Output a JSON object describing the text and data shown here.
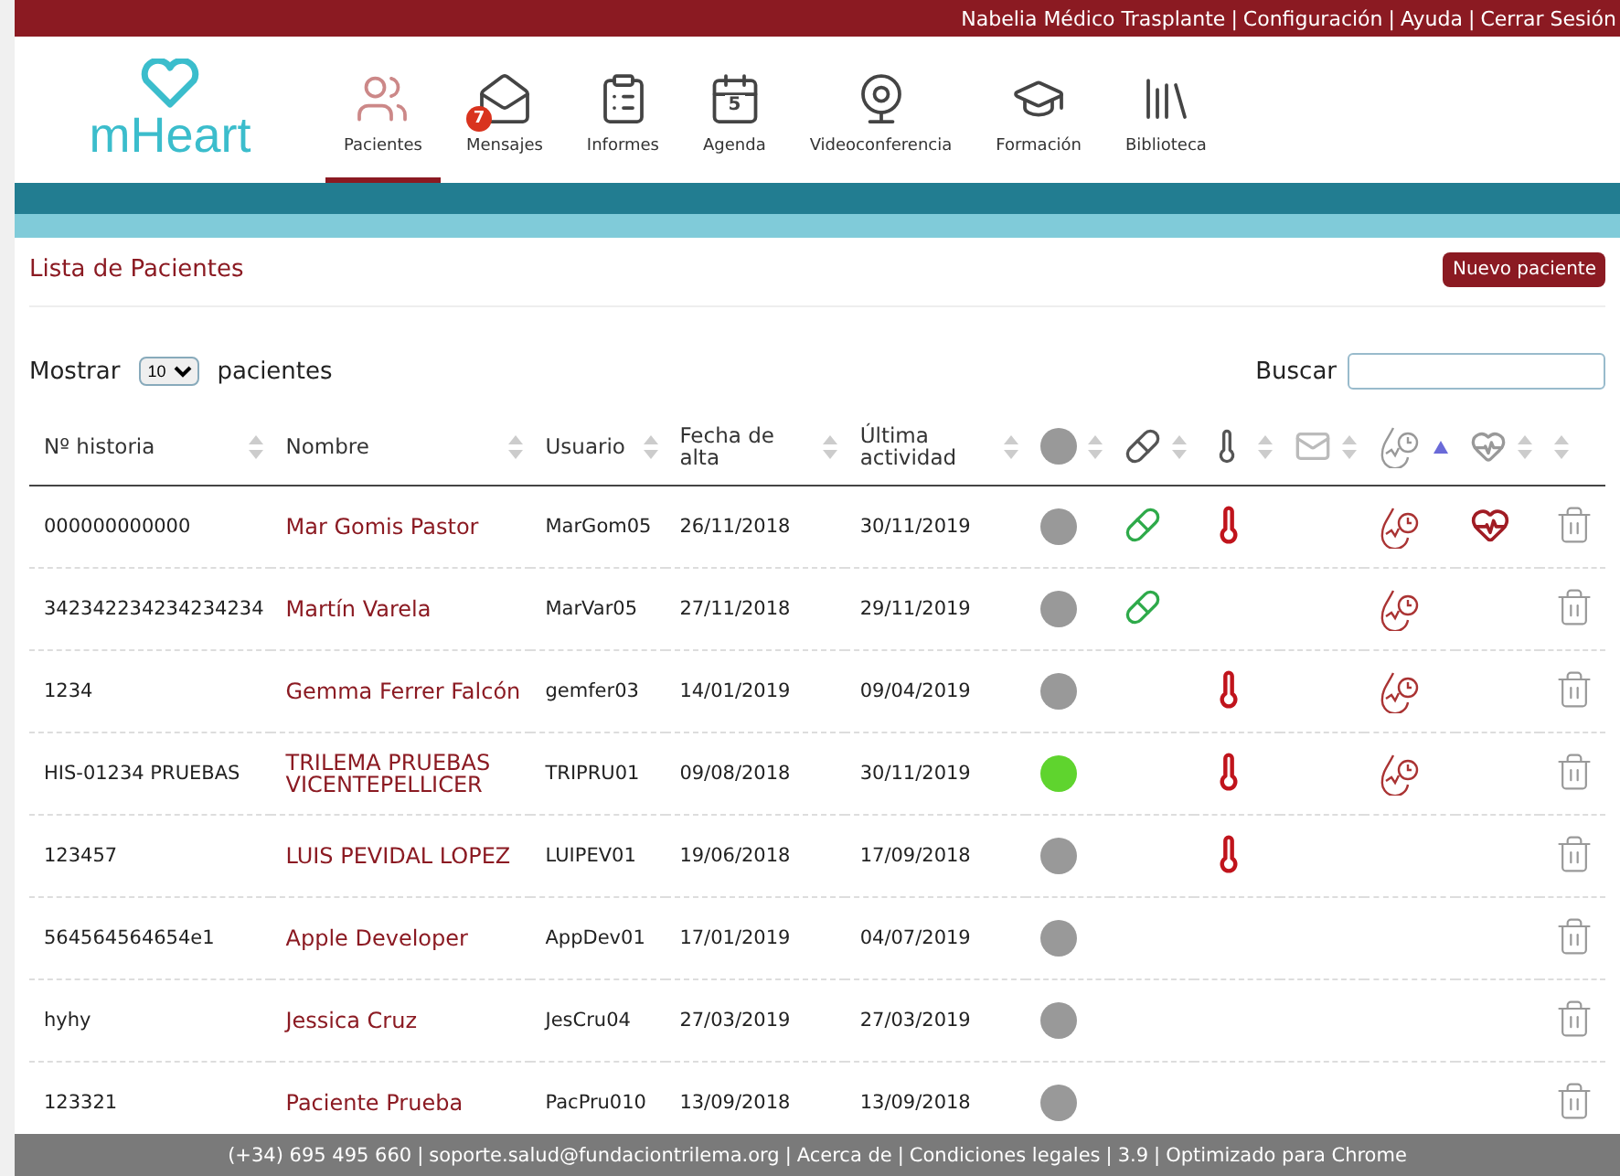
{
  "top_bar": {
    "items": [
      {
        "kind": "link",
        "text": "Nabelia Médico Trasplante"
      },
      {
        "kind": "separator",
        "text": "|"
      },
      {
        "kind": "link",
        "text": "Configuración"
      },
      {
        "kind": "separator",
        "text": "|"
      },
      {
        "kind": "link",
        "text": "Ayuda"
      },
      {
        "kind": "separator",
        "text": "|"
      },
      {
        "kind": "link",
        "text": "Cerrar Sesión"
      }
    ]
  },
  "logo": {
    "text": "mHeart"
  },
  "nav": [
    {
      "label": "Pacientes",
      "kind": "users",
      "selected": true
    },
    {
      "label": "Mensajes",
      "kind": "mail",
      "selected": false,
      "badge": "7"
    },
    {
      "label": "Informes",
      "kind": "clipboard",
      "selected": false
    },
    {
      "label": "Agenda",
      "kind": "calendar",
      "selected": false,
      "day": "5"
    },
    {
      "label": "Videoconferencia",
      "kind": "webcam",
      "selected": false
    },
    {
      "label": "Formación",
      "kind": "graduation",
      "selected": false
    },
    {
      "label": "Biblioteca",
      "kind": "library",
      "selected": false
    }
  ],
  "page_title": "Lista de Pacientes",
  "new_button": "Nuevo paciente",
  "length": {
    "before": "Mostrar",
    "value": "10",
    "after": "pacientes"
  },
  "search": {
    "label": "Buscar"
  },
  "columns": [
    {
      "kind": "text",
      "label": "Nº historia",
      "sorted": false
    },
    {
      "kind": "text",
      "label": "Nombre",
      "sorted": false
    },
    {
      "kind": "text",
      "label": "Usuario",
      "sorted": false
    },
    {
      "kind": "text",
      "label": "Fecha de alta",
      "sorted": false
    },
    {
      "kind": "text",
      "label": "Última actividad",
      "sorted": false
    },
    {
      "kind": "dot",
      "sorted": false
    },
    {
      "kind": "pill",
      "sorted": false
    },
    {
      "kind": "thermometer",
      "sorted": false
    },
    {
      "kind": "mail",
      "sorted": false
    },
    {
      "kind": "monitor",
      "sorted": true
    },
    {
      "kind": "heart",
      "sorted": false
    },
    {
      "kind": "blank",
      "sorted": false
    }
  ],
  "rows": [
    {
      "historia": "000000000000",
      "nombre": "Mar Gomis Pastor",
      "usuario": "MarGom05",
      "alta": "26/11/2018",
      "actividad": "30/11/2019",
      "color": "#999999",
      "pill": true,
      "thermometer": true,
      "monitor": true,
      "heart": true
    },
    {
      "historia": "342342234234234234",
      "nombre": "Martín Varela",
      "usuario": "MarVar05",
      "alta": "27/11/2018",
      "actividad": "29/11/2019",
      "color": "#999999",
      "pill": true,
      "thermometer": false,
      "monitor": true,
      "heart": false
    },
    {
      "historia": "1234",
      "nombre": "Gemma Ferrer Falcón",
      "usuario": "gemfer03",
      "alta": "14/01/2019",
      "actividad": "09/04/2019",
      "color": "#999999",
      "pill": false,
      "thermometer": true,
      "monitor": true,
      "heart": false
    },
    {
      "historia": "HIS-01234 PRUEBAS",
      "nombre": "TRILEMA PRUEBAS VICENTEPELLICER",
      "usuario": "TRIPRU01",
      "alta": "09/08/2018",
      "actividad": "30/11/2019",
      "color": "#5fd42e",
      "pill": false,
      "thermometer": true,
      "monitor": true,
      "heart": false
    },
    {
      "historia": "123457",
      "nombre": "LUIS PEVIDAL LOPEZ",
      "usuario": "LUIPEV01",
      "alta": "19/06/2018",
      "actividad": "17/09/2018",
      "color": "#999999",
      "pill": false,
      "thermometer": true,
      "monitor": false,
      "heart": false
    },
    {
      "historia": "564564564654e1",
      "nombre": "Apple Developer",
      "usuario": "AppDev01",
      "alta": "17/01/2019",
      "actividad": "04/07/2019",
      "color": "#999999",
      "pill": false,
      "thermometer": false,
      "monitor": false,
      "heart": false
    },
    {
      "historia": "hyhy",
      "nombre": "Jessica Cruz",
      "usuario": "JesCru04",
      "alta": "27/03/2019",
      "actividad": "27/03/2019",
      "color": "#999999",
      "pill": false,
      "thermometer": false,
      "monitor": false,
      "heart": false
    },
    {
      "historia": "123321",
      "nombre": "Paciente Prueba",
      "usuario": "PacPru010",
      "alta": "13/09/2018",
      "actividad": "13/09/2018",
      "color": "#999999",
      "pill": false,
      "thermometer": false,
      "monitor": false,
      "heart": false
    }
  ],
  "footer": [
    {
      "kind": "text",
      "text": "(+34) 695 495 660"
    },
    {
      "kind": "separator",
      "text": "|"
    },
    {
      "kind": "text",
      "text": "soporte.salud@fundaciontrilema.org"
    },
    {
      "kind": "separator",
      "text": "|"
    },
    {
      "kind": "link",
      "text": "Acerca de"
    },
    {
      "kind": "separator",
      "text": "|"
    },
    {
      "kind": "link",
      "text": "Condiciones legales"
    },
    {
      "kind": "separator",
      "text": "|"
    },
    {
      "kind": "text",
      "text": "3.9"
    },
    {
      "kind": "separator",
      "text": "|"
    },
    {
      "kind": "text",
      "text": "Optimizado para Chrome"
    }
  ]
}
